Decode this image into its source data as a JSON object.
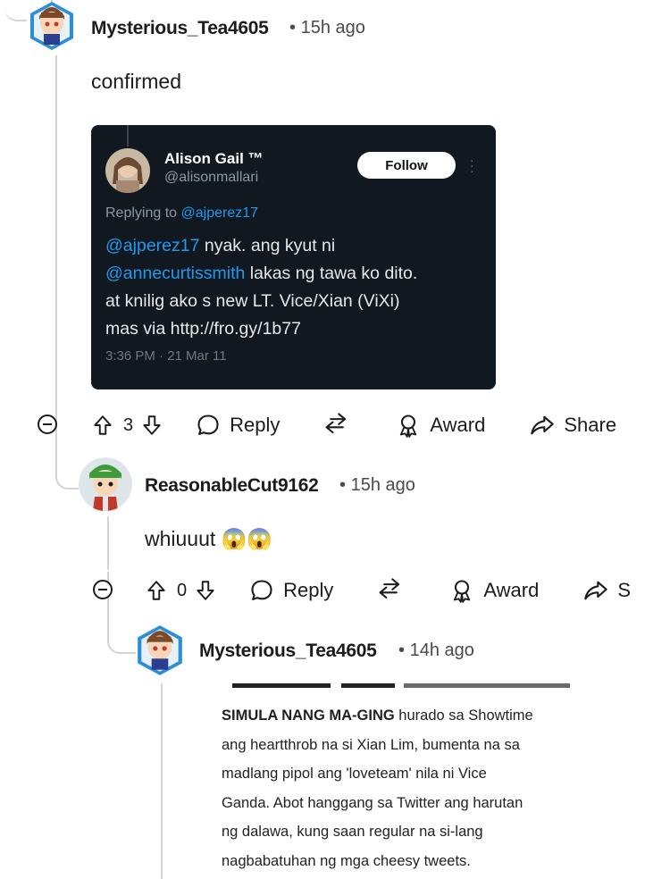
{
  "comments": [
    {
      "username": "Mysterious_Tea4605",
      "separator": "•",
      "time": "15h ago",
      "text": "confirmed",
      "votes": "3",
      "reply_label": "Reply",
      "award_label": "Award",
      "share_label": "Share"
    },
    {
      "username": "ReasonableCut9162",
      "separator": "•",
      "time": "15h ago",
      "text": "whiuuut",
      "emoji": "😱😱",
      "votes": "0",
      "reply_label": "Reply",
      "award_label": "Award",
      "share_label": "S"
    },
    {
      "username": "Mysterious_Tea4605",
      "separator": "•",
      "time": "14h ago"
    }
  ],
  "tweet": {
    "name": "Alison Gail ™",
    "handle": "@alisonmallari",
    "follow_label": "Follow",
    "replying_prefix": "Replying to ",
    "replying_to": "@ajperez17",
    "mention1": "@ajperez17",
    "text1": " nyak. ang kyut ni",
    "mention2": "@annecurtissmith",
    "text2": " lakas ng tawa ko dito.",
    "line3": "at knilig ako s new LT. Vice/Xian (ViXi)",
    "line4": "mas  via http://fro.gy/1b77",
    "timestamp": "3:36 PM · 21 Mar 11"
  },
  "article": {
    "lead": "SIMULA NANG MA-GING",
    "body": " hurado sa Showtime\nang heartthrob na si Xian Lim, bumenta na sa\nmadlang pipol ang 'loveteam' nila ni Vice\nGanda. Abot hanggang sa Twitter ang harutan\nng dalawa, kung saan regular na si-lang\nnagbabatuhan ng mga cheesy tweets."
  }
}
